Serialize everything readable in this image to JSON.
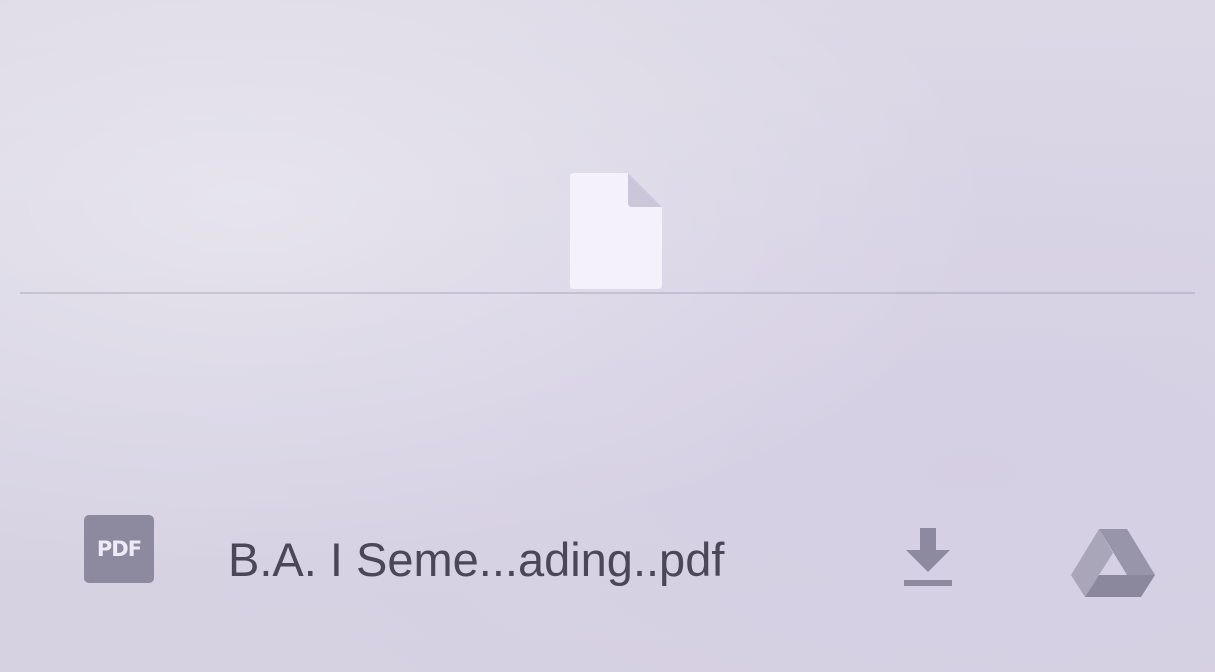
{
  "file": {
    "type_badge": "PDF",
    "name": "B.A. I Seme...ading..pdf"
  },
  "icons": {
    "preview": "blank-document-icon",
    "file_type": "pdf-icon",
    "download": "download-icon",
    "drive": "google-drive-icon"
  },
  "colors": {
    "background": "#d9d5e5",
    "text": "#4a4758",
    "icon_gray": "#8d8aa0",
    "document_white": "#f4f1fa"
  }
}
